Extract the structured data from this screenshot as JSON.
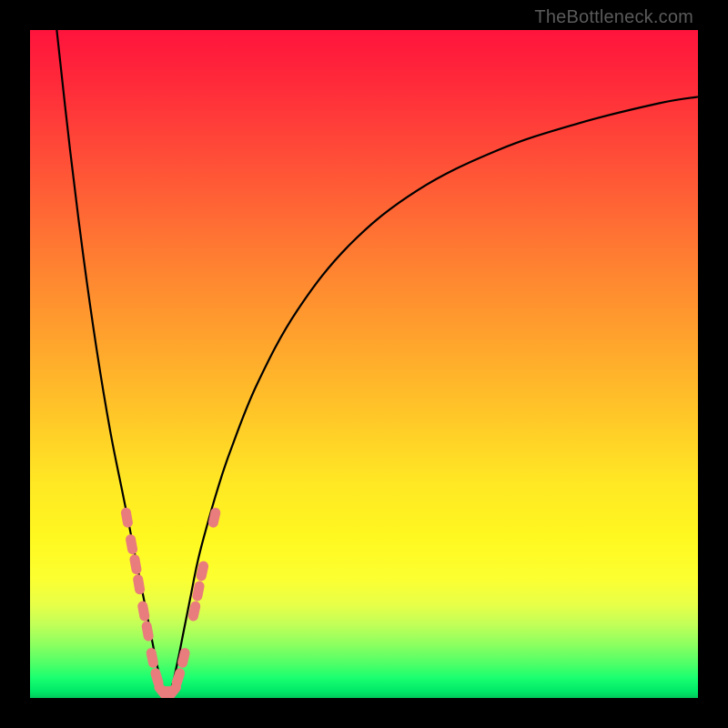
{
  "watermark": "TheBottleneck.com",
  "colors": {
    "frame": "#000000",
    "curve": "#000000",
    "marker": "#e97c7c"
  },
  "chart_data": {
    "type": "line",
    "title": "",
    "xlabel": "",
    "ylabel": "",
    "xlim": [
      0,
      100
    ],
    "ylim": [
      0,
      100
    ],
    "grid": false,
    "legend": false,
    "notes": "Bottleneck-style V curve. x is a normalized component-ratio axis (0–100); y is bottleneck percentage (0 = no bottleneck at bottom, 100 = max at top). Minimum is near x ≈ 20. Values are read off the plot by vertical position within the gradient.",
    "series": [
      {
        "name": "bottleneck-curve",
        "x": [
          4,
          6,
          8,
          10,
          12,
          14,
          16,
          17,
          18,
          19,
          20,
          21,
          22,
          23,
          24,
          25,
          26,
          28,
          30,
          34,
          40,
          48,
          58,
          70,
          82,
          94,
          100
        ],
        "y": [
          100,
          82,
          66,
          52,
          40,
          30,
          20,
          15,
          10,
          5,
          1,
          1,
          5,
          10,
          15,
          20,
          24,
          31,
          37,
          47,
          58,
          68,
          76,
          82,
          86,
          89,
          90
        ]
      }
    ],
    "markers": {
      "name": "highlighted-points",
      "note": "Salmon pill-shaped markers clustered on both branches near the minimum (roughly y ∈ [1, 25]).",
      "points": [
        {
          "x": 14.5,
          "y": 27
        },
        {
          "x": 15.2,
          "y": 23
        },
        {
          "x": 15.8,
          "y": 20
        },
        {
          "x": 16.3,
          "y": 17
        },
        {
          "x": 17.0,
          "y": 13
        },
        {
          "x": 17.6,
          "y": 10
        },
        {
          "x": 18.3,
          "y": 6
        },
        {
          "x": 19.0,
          "y": 3
        },
        {
          "x": 19.8,
          "y": 1
        },
        {
          "x": 20.6,
          "y": 1
        },
        {
          "x": 21.4,
          "y": 1
        },
        {
          "x": 22.2,
          "y": 3
        },
        {
          "x": 23.0,
          "y": 6
        },
        {
          "x": 24.6,
          "y": 13
        },
        {
          "x": 25.2,
          "y": 16
        },
        {
          "x": 25.8,
          "y": 19
        },
        {
          "x": 27.6,
          "y": 27
        }
      ]
    }
  }
}
